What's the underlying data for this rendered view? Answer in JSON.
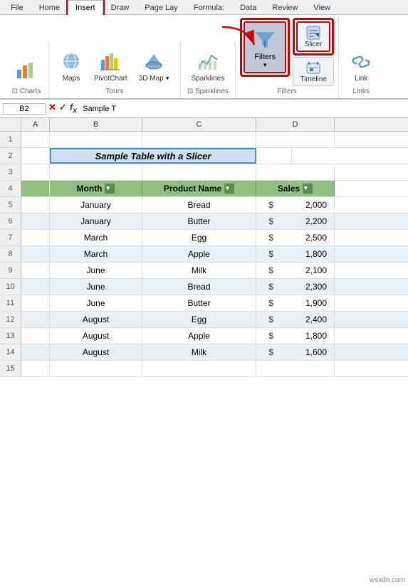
{
  "ribbon": {
    "tabs": [
      "File",
      "Home",
      "Insert",
      "Draw",
      "Page Layout",
      "Formulas",
      "Data",
      "Review",
      "View"
    ],
    "active_tab": "Insert",
    "groups": {
      "charts": {
        "label": "Charts",
        "dialog_label": "⊡"
      },
      "tours": {
        "label": "Tours",
        "buttons": [
          "Maps",
          "PivotChart",
          "3D Map ▾"
        ]
      },
      "sparklines": {
        "label": "Sparklines",
        "buttons": [
          "Sparklines"
        ]
      },
      "filters": {
        "label": "Filters",
        "main_btn": "Filters",
        "sub_btns": [
          "Slicer",
          "Timeline"
        ]
      },
      "links": {
        "label": "Links",
        "buttons": [
          "Link"
        ]
      }
    }
  },
  "formula_bar": {
    "cell_ref": "B2",
    "formula": "Sample T"
  },
  "spreadsheet": {
    "col_headers": [
      "A",
      "B",
      "C",
      "D"
    ],
    "rows": [
      {
        "num": "1",
        "cells": [
          "",
          "",
          "",
          ""
        ]
      },
      {
        "num": "2",
        "cells": [
          "",
          "Sample Table with a Slicer",
          "",
          ""
        ],
        "type": "title"
      },
      {
        "num": "3",
        "cells": [
          "",
          "",
          "",
          ""
        ]
      },
      {
        "num": "4",
        "cells": [
          "",
          "Month",
          "Product Name",
          "Sales"
        ],
        "type": "header"
      },
      {
        "num": "5",
        "cells": [
          "",
          "January",
          "Bread",
          "$",
          "2,000"
        ],
        "type": "white"
      },
      {
        "num": "6",
        "cells": [
          "",
          "January",
          "Butter",
          "$",
          "2,200"
        ],
        "type": "blue"
      },
      {
        "num": "7",
        "cells": [
          "",
          "March",
          "Egg",
          "$",
          "2,500"
        ],
        "type": "white"
      },
      {
        "num": "8",
        "cells": [
          "",
          "March",
          "Apple",
          "$",
          "1,800"
        ],
        "type": "blue"
      },
      {
        "num": "9",
        "cells": [
          "",
          "June",
          "Milk",
          "$",
          "2,100"
        ],
        "type": "white"
      },
      {
        "num": "10",
        "cells": [
          "",
          "June",
          "Bread",
          "$",
          "2,300"
        ],
        "type": "blue"
      },
      {
        "num": "11",
        "cells": [
          "",
          "June",
          "Butter",
          "$",
          "1,900"
        ],
        "type": "white"
      },
      {
        "num": "12",
        "cells": [
          "",
          "August",
          "Egg",
          "$",
          "2,400"
        ],
        "type": "blue"
      },
      {
        "num": "13",
        "cells": [
          "",
          "August",
          "Apple",
          "$",
          "1,800"
        ],
        "type": "white"
      },
      {
        "num": "14",
        "cells": [
          "",
          "August",
          "Milk",
          "$",
          "1,600"
        ],
        "type": "blue"
      },
      {
        "num": "15",
        "cells": [
          "",
          "",
          "",
          ""
        ]
      }
    ]
  },
  "watermark": "wsxdn.com"
}
